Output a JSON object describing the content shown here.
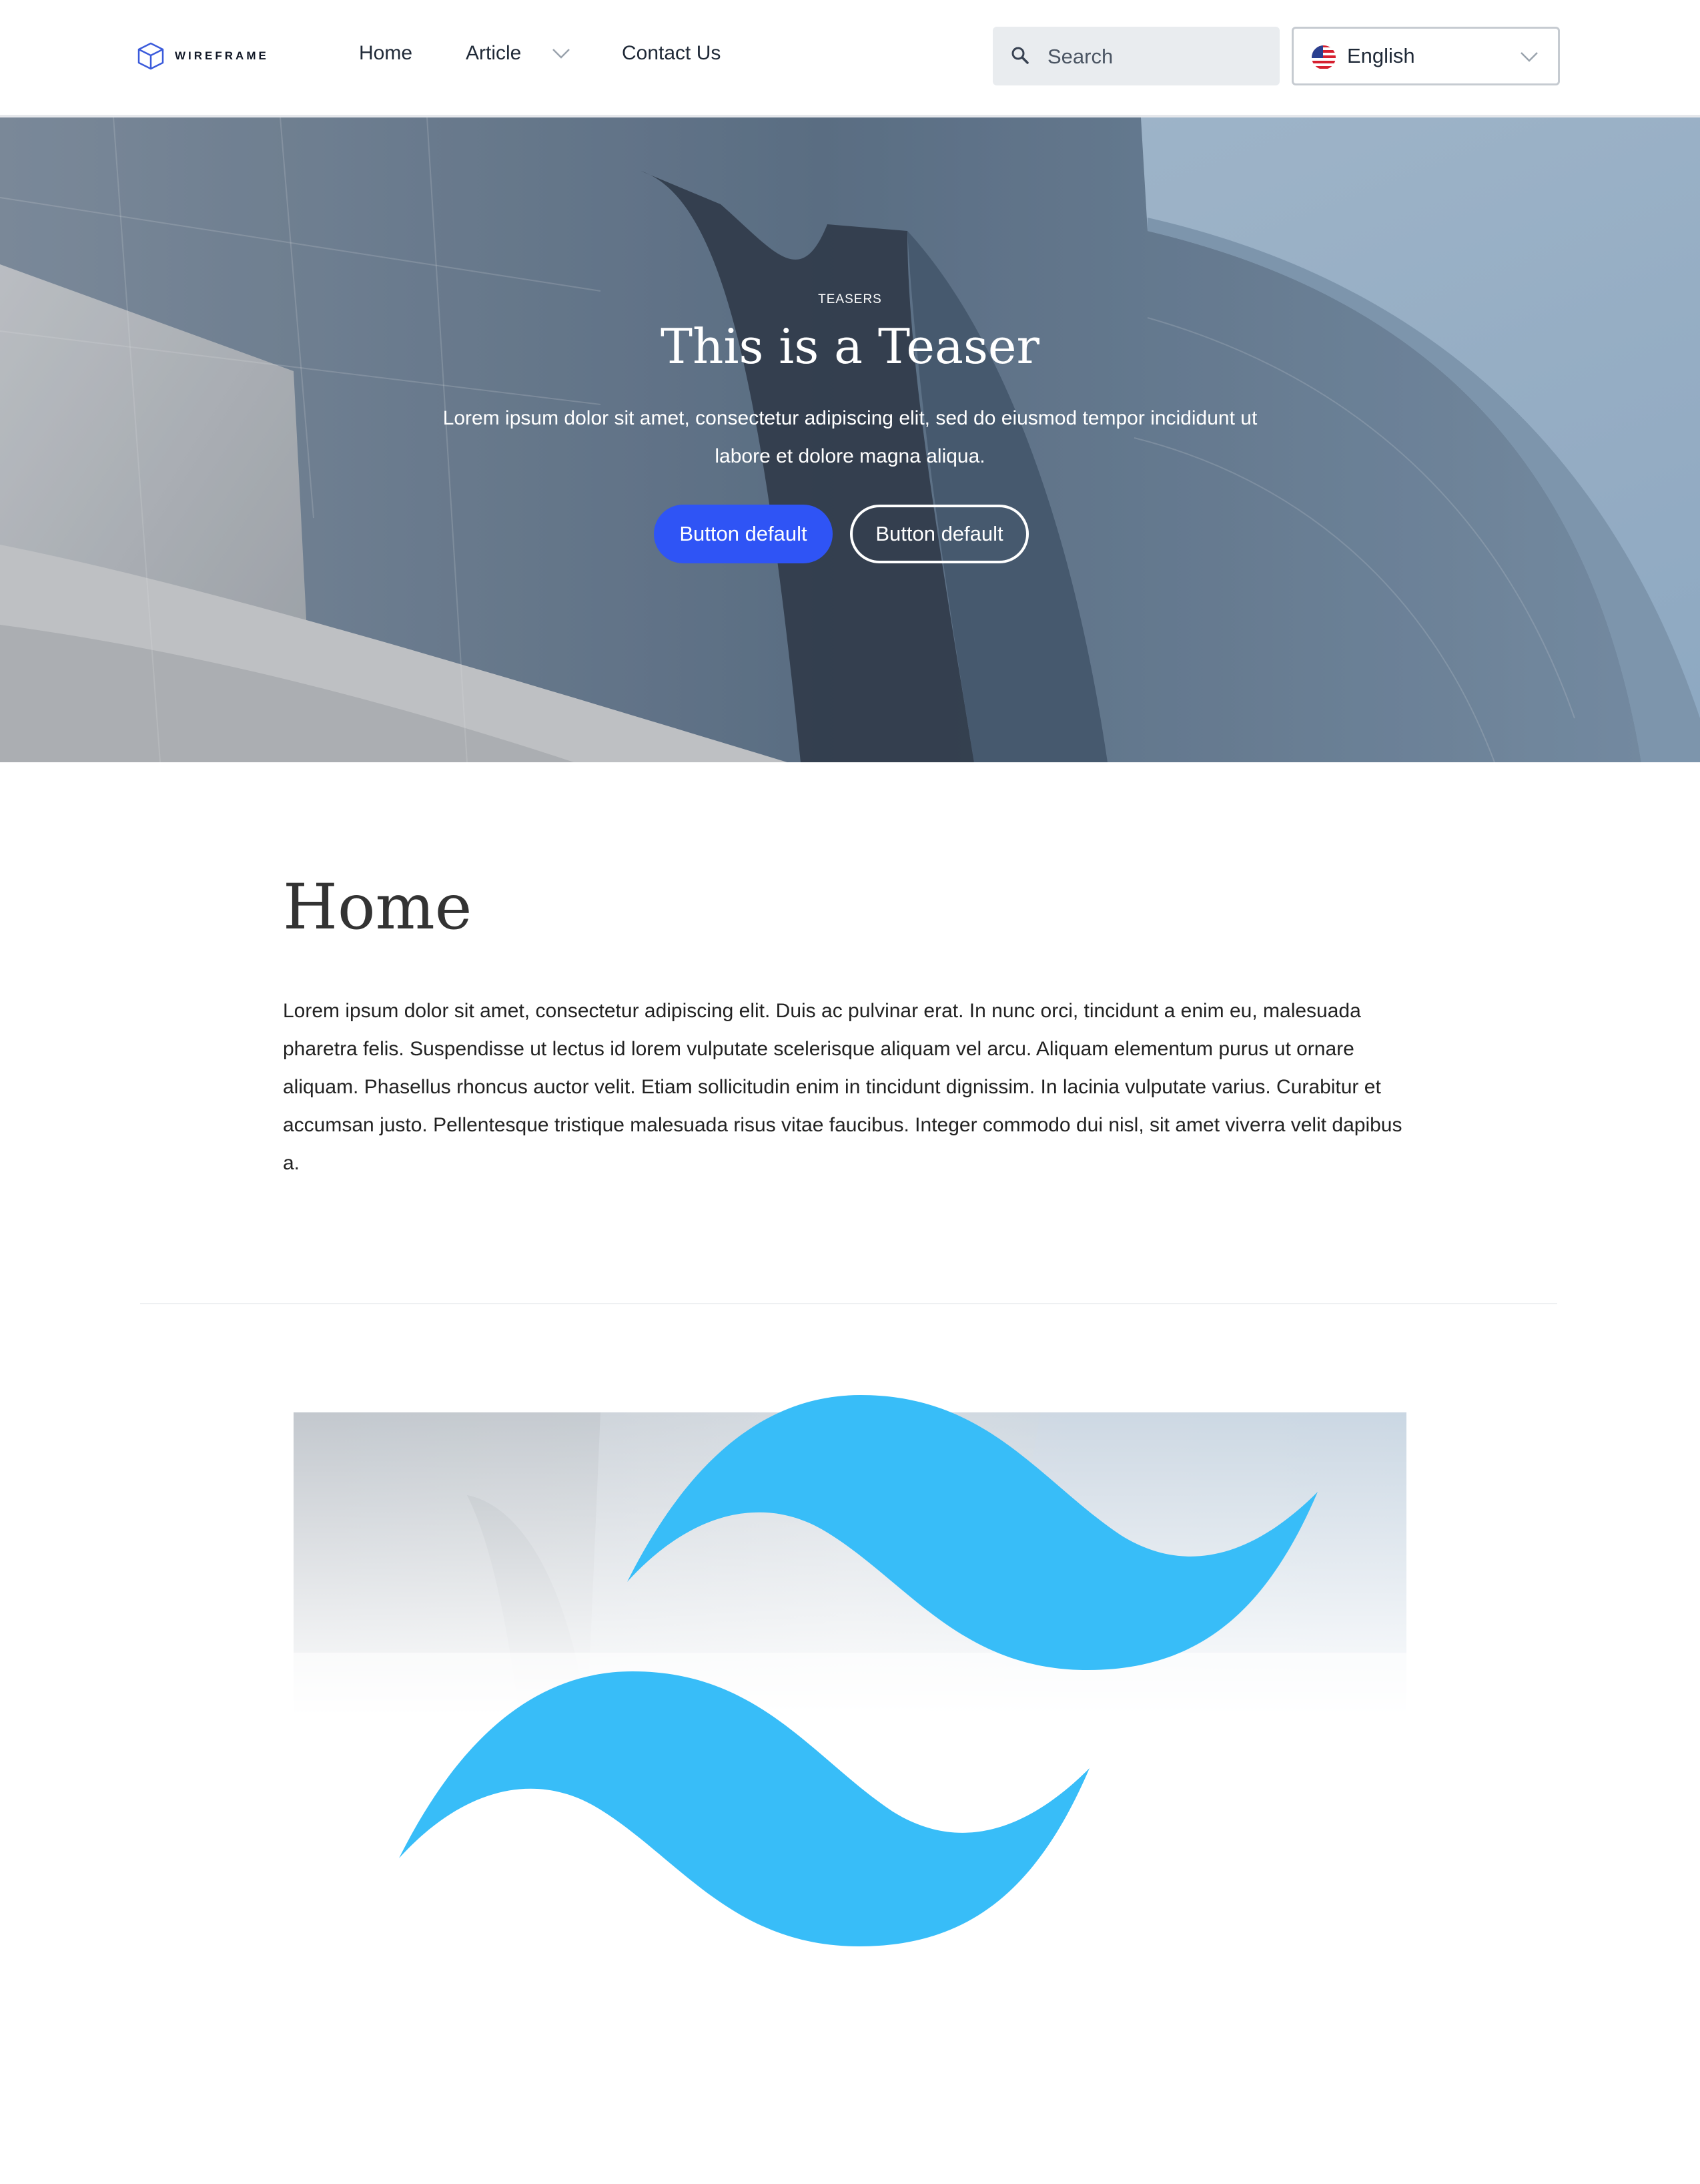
{
  "header": {
    "logo_text": "WIREFRAME",
    "nav": {
      "home": "Home",
      "article": "Article",
      "contact": "Contact Us"
    },
    "search_placeholder": "Search",
    "language": "English"
  },
  "hero": {
    "eyebrow": "TEASERS",
    "title": "This is a Teaser",
    "text": "Lorem ipsum dolor sit amet, consectetur adipiscing elit, sed do eiusmod tempor incididunt ut labore et dolore magna aliqua.",
    "primary_button": "Button default",
    "secondary_button": "Button default"
  },
  "main": {
    "title": "Home",
    "body": "Lorem ipsum dolor sit amet, consectetur adipiscing elit. Duis ac pulvinar erat. In nunc orci, tincidunt a enim eu, malesuada pharetra felis. Suspendisse ut lectus id lorem vulputate scelerisque aliquam vel arcu. Aliquam elementum purus ut ornare aliquam. Phasellus rhoncus auctor velit. Etiam sollicitudin enim in tincidunt dignissim. In lacinia vulputate varius. Curabitur et accumsan justo. Pellentesque tristique malesuada risus vitae faucibus. Integer commodo dui nisl, sit amet viverra velit dapibus a."
  },
  "colors": {
    "primary": "#2f54f5",
    "tailwind_blue": "#38bdf8",
    "text_dark": "#333333"
  },
  "icons": [
    "logo-cube-icon",
    "chevron-down-icon",
    "search-icon",
    "us-flag-icon",
    "tailwind-logo-icon"
  ]
}
